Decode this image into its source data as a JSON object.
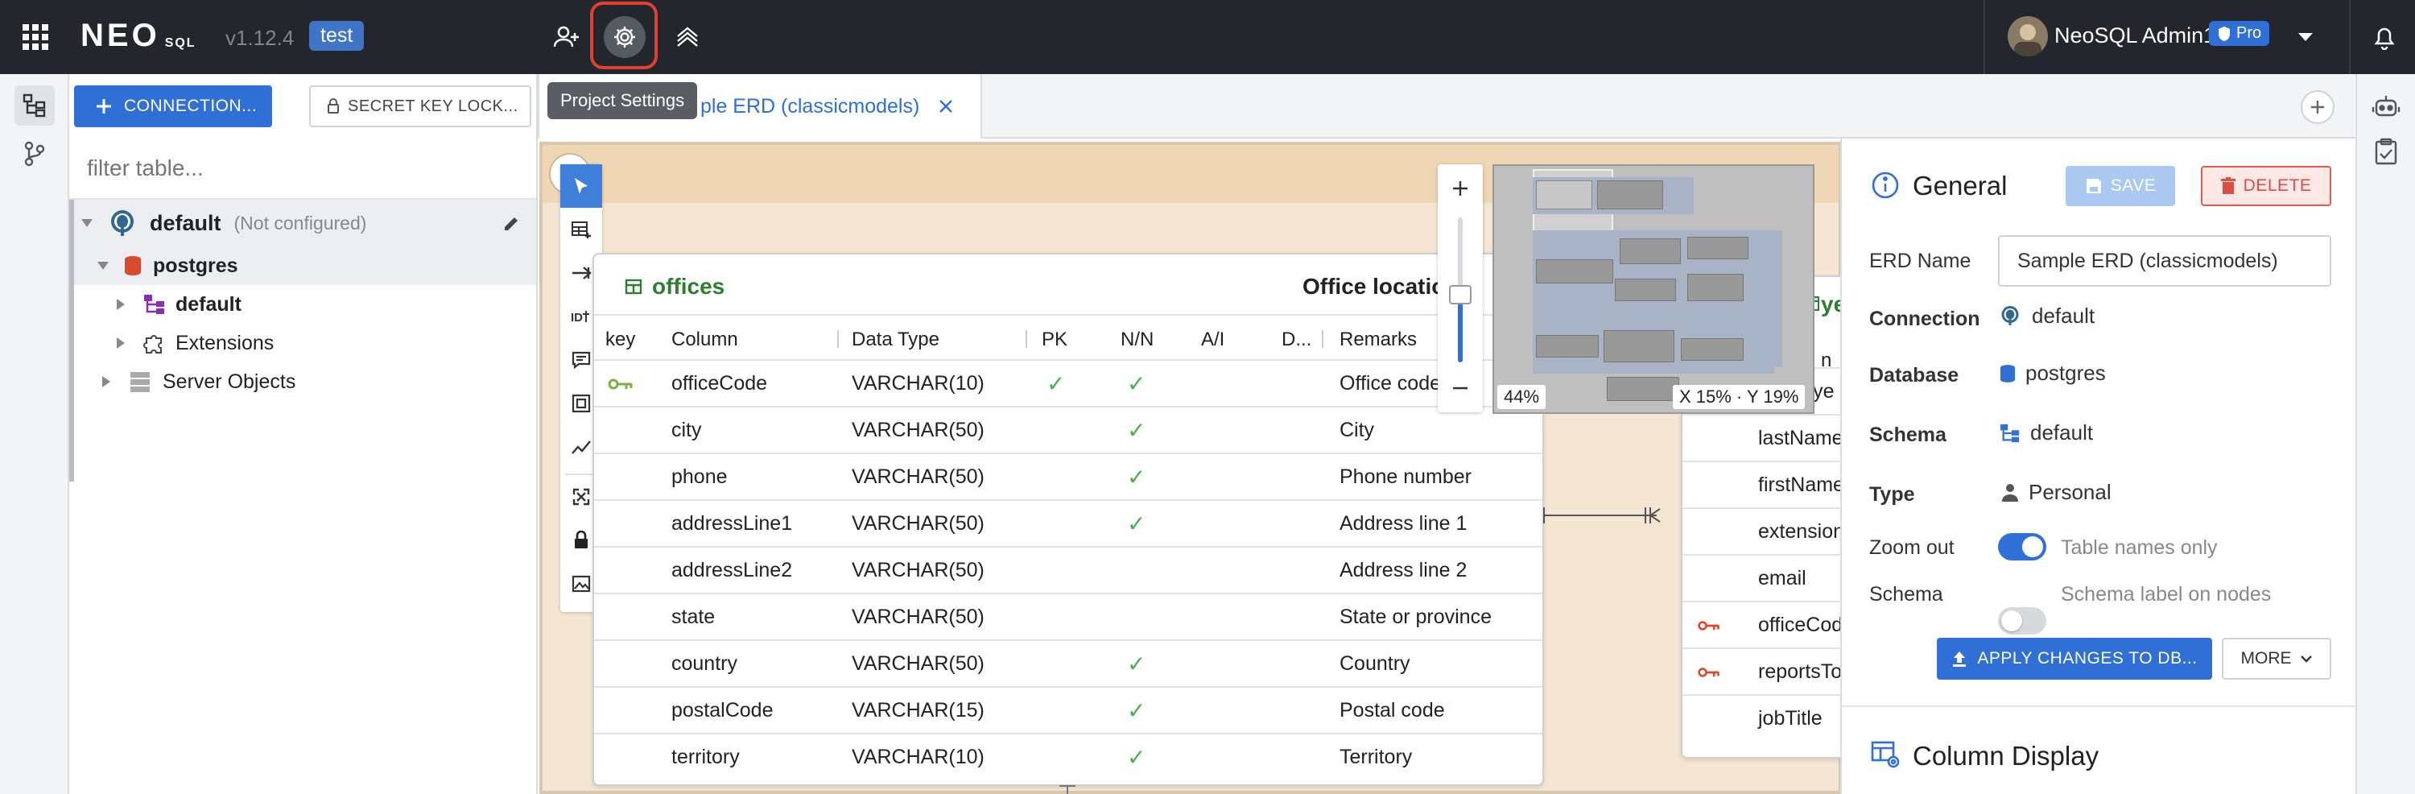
{
  "topbar": {
    "logo": "NEO",
    "logo_suffix": "SQL",
    "version": "v1.12.4",
    "env_badge": "test",
    "user_name": "NeoSQL Admin1",
    "pro_label": "Pro"
  },
  "tooltip": {
    "text": "Project Settings"
  },
  "sidebar": {
    "connection_button": "CONNECTION...",
    "secret_key_button": "SECRET KEY LOCK...",
    "filter_placeholder": "filter table...",
    "tree": {
      "root_label": "default",
      "root_status": "(Not configured)",
      "db_label": "postgres",
      "schema_label": "default",
      "extensions_label": "Extensions",
      "server_objects_label": "Server Objects"
    }
  },
  "tabs": [
    {
      "label": "Sample ERD (classicmodels)",
      "visible_label": "ple ERD (classicmodels)"
    }
  ],
  "erd": {
    "offices": {
      "name": "offices",
      "comment": "Office locatio",
      "headers": [
        "key",
        "Column",
        "Data Type",
        "PK",
        "N/N",
        "A/I",
        "D...",
        "Remarks"
      ],
      "rows": [
        {
          "column": "officeCode",
          "type": "VARCHAR(10)",
          "pk": true,
          "nn": true,
          "remarks": "Office code"
        },
        {
          "column": "city",
          "type": "VARCHAR(50)",
          "pk": false,
          "nn": true,
          "remarks": "City"
        },
        {
          "column": "phone",
          "type": "VARCHAR(50)",
          "pk": false,
          "nn": true,
          "remarks": "Phone number"
        },
        {
          "column": "addressLine1",
          "type": "VARCHAR(50)",
          "pk": false,
          "nn": true,
          "remarks": "Address line 1"
        },
        {
          "column": "addressLine2",
          "type": "VARCHAR(50)",
          "pk": false,
          "nn": false,
          "remarks": "Address line 2"
        },
        {
          "column": "state",
          "type": "VARCHAR(50)",
          "pk": false,
          "nn": false,
          "remarks": "State or province"
        },
        {
          "column": "country",
          "type": "VARCHAR(50)",
          "pk": false,
          "nn": true,
          "remarks": "Country"
        },
        {
          "column": "postalCode",
          "type": "VARCHAR(15)",
          "pk": false,
          "nn": true,
          "remarks": "Postal code"
        },
        {
          "column": "territory",
          "type": "VARCHAR(10)",
          "pk": false,
          "nn": true,
          "remarks": "Territory"
        }
      ]
    },
    "employees": {
      "title_partial": "yee",
      "header_partial": "n",
      "rows": [
        "employe",
        "lastName",
        "firstName",
        "extension",
        "email",
        "officeCod",
        "reportsTo",
        "jobTitle"
      ]
    },
    "zoom_percent": "44%",
    "position": "X 15% · Y 19%"
  },
  "panel": {
    "title": "General",
    "save": "SAVE",
    "delete": "DELETE",
    "erd_name_label": "ERD Name",
    "erd_name_value": "Sample ERD (classicmodels)",
    "connection_label": "Connection",
    "connection_value": "default",
    "database_label": "Database",
    "database_value": "postgres",
    "schema_label": "Schema",
    "schema_value": "default",
    "type_label": "Type",
    "type_value": "Personal",
    "zoom_out_label": "Zoom out",
    "zoom_out_toggle": "Table names only",
    "schema_toggle_label": "Schema",
    "schema_toggle": "Schema label on nodes",
    "apply": "APPLY CHANGES TO DB...",
    "more": "MORE",
    "column_display": "Column Display"
  },
  "colors": {
    "accent": "#2f6fd6",
    "topbar": "#23272d",
    "canvas": "#f4e6d2",
    "table_title": "#2e7d32",
    "highlight": "#e0412f"
  }
}
